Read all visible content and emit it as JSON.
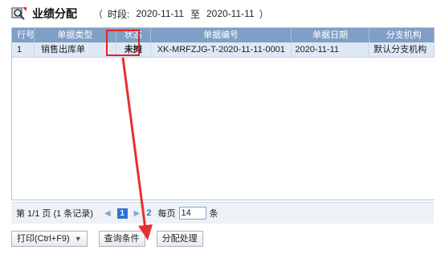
{
  "header": {
    "title": "业绩分配",
    "open_paren": "（",
    "period_label": "时段:",
    "start_date": "2020-11-11",
    "to_label": "至",
    "end_date": "2020-11-11",
    "close_paren": "）"
  },
  "table": {
    "columns": [
      "行号",
      "单据类型",
      "状态",
      "单据编号",
      "单据日期",
      "分支机构"
    ],
    "rows": [
      {
        "rowno": "1",
        "type": "销售出库单",
        "status": "未摊",
        "number": "XK-MRFZJG-T-2020-11-11-0001",
        "date": "2020-11-11",
        "branch": "默认分支机构"
      }
    ]
  },
  "pager": {
    "page_info": "第 1/1 页 (1 条记录)",
    "first_arrow": "◀",
    "current_page": "1",
    "next_arrow": "▶",
    "page_2": "2",
    "per_page_label": "每页",
    "per_page_value": "14",
    "per_page_unit": "条"
  },
  "buttons": {
    "print_label": "打印(Ctrl+F9)",
    "query_label": "查询条件",
    "allocate_label": "分配处理"
  },
  "colors": {
    "header_bg": "#7f9fc6",
    "row_bg": "#dfe9f5",
    "status_text": "#1a8a1a",
    "highlight": "#e02424",
    "page_active": "#2f73d9"
  }
}
